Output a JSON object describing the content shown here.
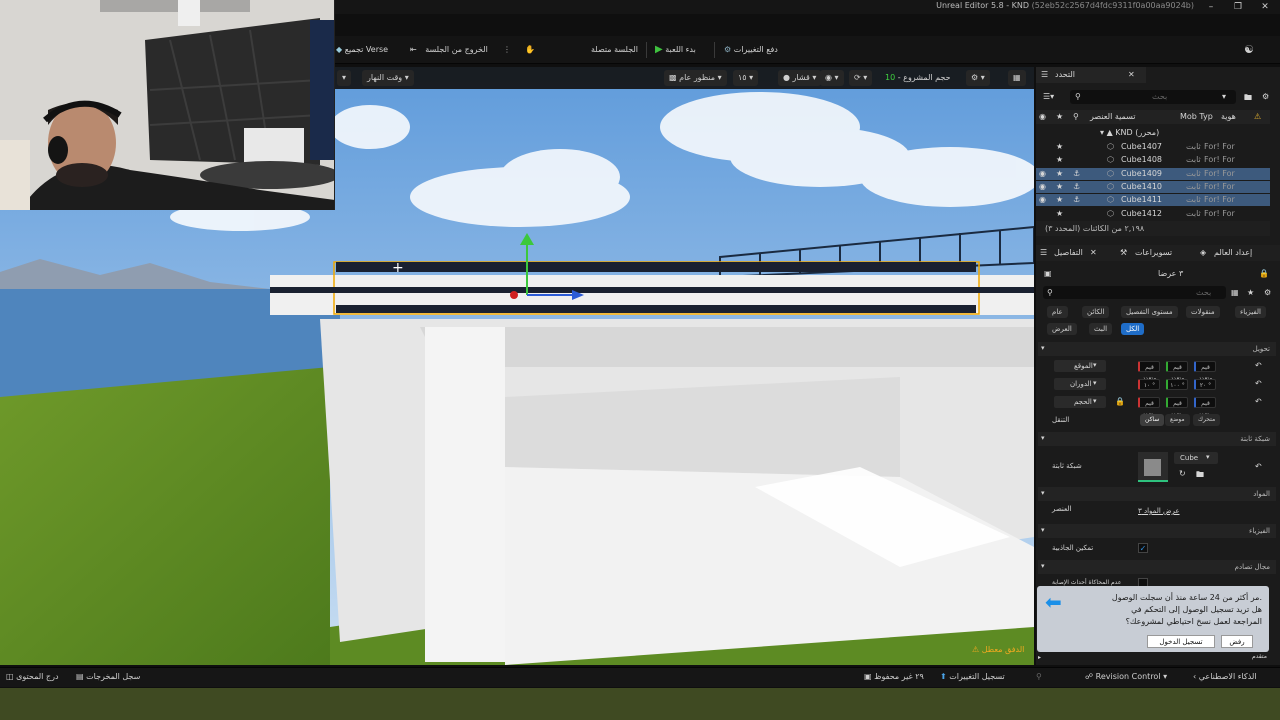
{
  "window": {
    "title": "Unreal Editor 5.8 - KND",
    "hash": "(52eb52c2567d4fdc9311f0a00aa9024b)"
  },
  "toolbar": {
    "verse_build": "تجميع Verse",
    "exit_session": "الخروج من الجلسة",
    "session_connected": "الجلسة متصلة",
    "start_game": "بدء اللعبة",
    "push_changes": "دفع التغييرات"
  },
  "viewport_toolbar": {
    "time_of_day": "وقت النهار",
    "perspective": "منظور عام",
    "fov": "١٥",
    "lit": "قشار",
    "project_size_label": "حجم المشروع -",
    "project_size_value": "10"
  },
  "viewport": {
    "warning": "الدفق معطل"
  },
  "outliner": {
    "tab_label": "التحدد",
    "col_name": "تسمية العنصر",
    "col_type": "Mob Typ",
    "col_id": "هوية",
    "search_placeholder": "بحث",
    "folder": "KND (محرر)",
    "items": [
      {
        "name": "Cube1407",
        "type": "ثابت",
        "extra": "For! For",
        "selected": false
      },
      {
        "name": "Cube1408",
        "type": "ثابت",
        "extra": "For! For",
        "selected": false
      },
      {
        "name": "Cube1409",
        "type": "ثابت",
        "extra": "For! For",
        "selected": true
      },
      {
        "name": "Cube1410",
        "type": "ثابت",
        "extra": "For! For",
        "selected": true
      },
      {
        "name": "Cube1411",
        "type": "ثابت",
        "extra": "For! For",
        "selected": true
      },
      {
        "name": "Cube1412",
        "type": "ثابت",
        "extra": "For! For",
        "selected": false
      }
    ],
    "count": "٢,١٩٨ من الكائنات (المحدد ٣)"
  },
  "details": {
    "tab_world": "إعداد العالم",
    "tab_settings": "تسويراعات",
    "tab_details": "التفاصيل",
    "count": "٣ عرضا",
    "search_placeholder": "بحث",
    "filters_row1": [
      "الفيزياء",
      "منقولات",
      "مستوى التفصيل",
      "الكائن",
      "عام"
    ],
    "filters_row2": [
      "الكل",
      "البث",
      "العرض"
    ],
    "section_transform": "تحويل",
    "location": "الموقع",
    "rotation": "الدوران",
    "scale": "الحجم",
    "values_label": "قيم متعدد",
    "rot_values": [
      "١٠ °",
      "١٠٠ °",
      "٢٠ °"
    ],
    "mobility": "التنقل",
    "mobility_options": [
      "متحرك",
      "موضع",
      "ساكن"
    ],
    "section_mesh": "شبكة ثابتة",
    "mesh_label": "شبكة ثابتة",
    "mesh_name": "Cube",
    "section_materials": "المواد",
    "element_label": "العنصر",
    "element_value": "عرض المواد ٣",
    "section_physics": "الفيزياء",
    "gravity_label": "تمكين الجاذبية",
    "section_collision": "مجال تصادم",
    "collision_label": "عدم المحاكاة أحداث الإصابة",
    "advanced": "متقدم"
  },
  "notification": {
    "line1": "مر أكثر من 24 ساعة منذ أن سجلت الوصول.",
    "line2": "هل تريد تسجيل الوصول إلى التحكم في",
    "line3": "المراجعة لعمل نسخ احتياطي لمشروعك؟",
    "checkin": "تسجيل الدخول",
    "dismiss": "رفض"
  },
  "bottombar": {
    "content_drawer": "درج المحتوى",
    "output_log": "سجل المخرجات",
    "unsaved": "٢٩ غير محفوظ",
    "changelists": "تسجيل التغييرات",
    "revision_control": "Revision Control",
    "ai": "الذكاء الاصطناعي"
  }
}
